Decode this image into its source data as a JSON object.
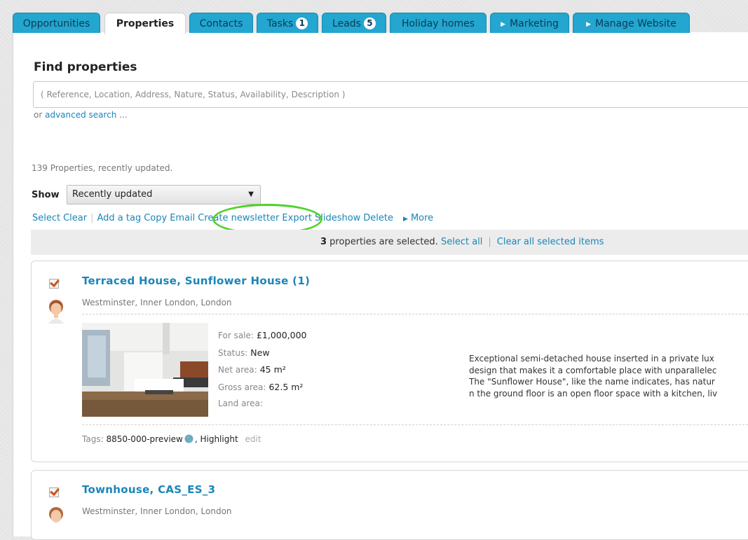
{
  "tabs": [
    {
      "label": "Opportunities",
      "active": false
    },
    {
      "label": "Properties",
      "active": true
    },
    {
      "label": "Contacts",
      "active": false
    },
    {
      "label": "Tasks",
      "badge": "1",
      "active": false
    },
    {
      "label": "Leads",
      "badge": "5",
      "active": false
    },
    {
      "label": "Holiday homes",
      "active": false
    },
    {
      "label": "Marketing",
      "active": false,
      "arrow": true
    },
    {
      "label": "Manage Website",
      "active": false,
      "arrow": true
    }
  ],
  "search": {
    "title": "Find properties",
    "placeholder": "( Reference, Location, Address, Nature, Status, Availability, Description )",
    "or_text": "or ",
    "advanced_link": "advanced search",
    "advanced_suffix": " ..."
  },
  "results": {
    "count_text": "139 Properties, recently updated.",
    "show_label": "Show",
    "show_value": "Recently updated"
  },
  "actions": {
    "select": "Select",
    "clear": "Clear",
    "add_tag": "Add a tag",
    "copy": "Copy",
    "email": "Email",
    "create_newsletter": "Create newsletter",
    "export": "Export",
    "slideshow": "Slideshow",
    "delete": "Delete",
    "more": "More"
  },
  "selection": {
    "count": "3",
    "text": " properties are selected.",
    "select_all": "Select all",
    "separator": "|",
    "clear_all": "Clear all selected items"
  },
  "properties": [
    {
      "title": "Terraced House, Sunflower House (1)",
      "location": "Westminster, Inner London, London",
      "for_sale_label": "For sale:",
      "for_sale_value": "£1,000,000",
      "status_label": "Status:",
      "status_value": "New",
      "net_area_label": "Net area:",
      "net_area_value": "45 m²",
      "gross_area_label": "Gross area:",
      "gross_area_value": "62.5 m²",
      "land_area_label": "Land area:",
      "description": [
        "Exceptional semi-detached house inserted in a private lux",
        "design that makes it a comfortable place with unparallelec",
        "The \"Sunflower House\", like the name indicates, has natur",
        "n the ground floor is an open floor space with a kitchen, liv"
      ],
      "tags_label": "Tags:",
      "tag1": "8850-000-preview",
      "tag2": ", Highlight",
      "edit": "edit",
      "selected": true
    },
    {
      "title": "Townhouse, CAS_ES_3",
      "location": "Westminster, Inner London, London",
      "selected": true
    }
  ],
  "colors": {
    "tab_blue": "#23a6cf",
    "link_blue": "#1a86b8",
    "highlight_green": "#4fd12b",
    "checkbox_orange": "#c8541b"
  }
}
